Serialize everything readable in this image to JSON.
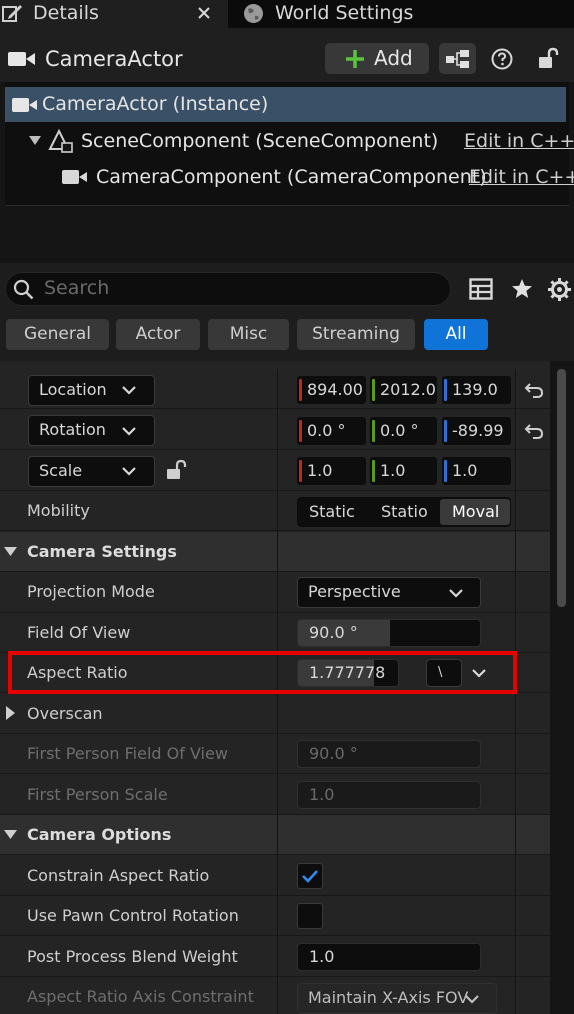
{
  "tabs": {
    "details": "Details",
    "world": "World Settings"
  },
  "header": {
    "actor_name": "CameraActor",
    "add_label": "Add"
  },
  "tree": {
    "root": "CameraActor (Instance)",
    "scene": "SceneComponent (SceneComponent)",
    "camera": "CameraComponent (CameraComponent)",
    "edit_link": "Edit in C++"
  },
  "search": {
    "placeholder": "Search"
  },
  "categories": [
    "General",
    "Actor",
    "Misc",
    "Streaming",
    "All"
  ],
  "transform": {
    "location_label": "Location",
    "rotation_label": "Rotation",
    "scale_label": "Scale",
    "location": [
      "894.00",
      "2012.0",
      "139.0"
    ],
    "rotation": [
      "0.0 °",
      "0.0 °",
      "-89.99"
    ],
    "scale": [
      "1.0",
      "1.0",
      "1.0"
    ]
  },
  "mobility": {
    "label": "Mobility",
    "options": [
      "Static",
      "Statio",
      "Moval"
    ],
    "selected": "Moval"
  },
  "camera_settings": {
    "title": "Camera Settings",
    "projection_label": "Projection Mode",
    "projection_value": "Perspective",
    "fov_label": "Field Of View",
    "fov_value": "90.0 °",
    "aspect_label": "Aspect Ratio",
    "aspect_value": "1.777778",
    "aspect_preset": "\\",
    "overscan_label": "Overscan",
    "fp_fov_label": "First Person Field Of View",
    "fp_fov_value": "90.0 °",
    "fp_scale_label": "First Person Scale",
    "fp_scale_value": "1.0"
  },
  "camera_options": {
    "title": "Camera Options",
    "constrain_label": "Constrain Aspect Ratio",
    "constrain_checked": true,
    "pawn_label": "Use Pawn Control Rotation",
    "pawn_checked": false,
    "blend_label": "Post Process Blend Weight",
    "blend_value": "1.0",
    "axis_label": "Aspect Ratio Axis Constraint",
    "axis_value": "Maintain X-Axis FOV"
  },
  "colors": {
    "accent": "#0f73d8",
    "selection": "#3a5067",
    "highlight": "#e60000",
    "x_axis": "#c0271f",
    "y_axis": "#5a9a1c",
    "z_axis": "#2f6fd6"
  }
}
